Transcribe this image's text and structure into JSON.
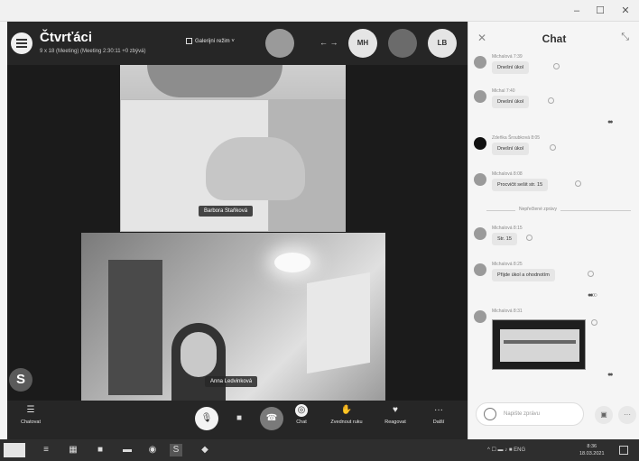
{
  "window": {
    "minimize": "–",
    "maximize": "☐",
    "close": "✕"
  },
  "meeting": {
    "title": "Čtvrťáci",
    "subtitle": "9 x 18 (Meeting) (Meeting 2:30:11 +0 zbývá)",
    "layout_label": "Galerijní režim",
    "arrows": "← →"
  },
  "participants": [
    {
      "initials": "",
      "color": "#9a9a9a"
    },
    {
      "initials": "MH",
      "color": "#e5e5e5"
    },
    {
      "initials": "",
      "color": "#6b6b6b"
    },
    {
      "initials": "LB",
      "color": "#e5e5e5"
    }
  ],
  "video_tiles": [
    {
      "name": "Barbora Staňková"
    },
    {
      "name": "Anna Ledvinková"
    }
  ],
  "skype_badge": "S",
  "controls": {
    "chat_hint": "Chatovat",
    "chat": "Chat",
    "raise_hand": "Zvednout ruku",
    "reactions": "Reagovat",
    "more": "Další"
  },
  "chat": {
    "title": "Chat",
    "messages": [
      {
        "sender": "Michalová 7:39",
        "text": "Dnešní úkol"
      },
      {
        "sender": "Michal 7:40",
        "text": "Dnešní úkol"
      },
      {
        "sender": "Zdeňka Šroubková 8:05",
        "text": "Dnešní úkol"
      },
      {
        "sender": "Michalová 8:08",
        "text": "Procvičit sešit str. 15"
      },
      {
        "sender": "Michalová 8:15",
        "text": "Str. 15"
      },
      {
        "sender": "Michalová 8:25",
        "text": "Přijde úkol a ohodnotím"
      },
      {
        "sender": "Michalová 8:31",
        "text": ""
      }
    ],
    "divider": "Nepřečtené zprávy",
    "compose_placeholder": "Napište zprávu"
  },
  "taskbar": {
    "tray": "^ ☐ ▬ ♪ ■ ENG",
    "time": "8:36",
    "date": "18.03.2021"
  }
}
